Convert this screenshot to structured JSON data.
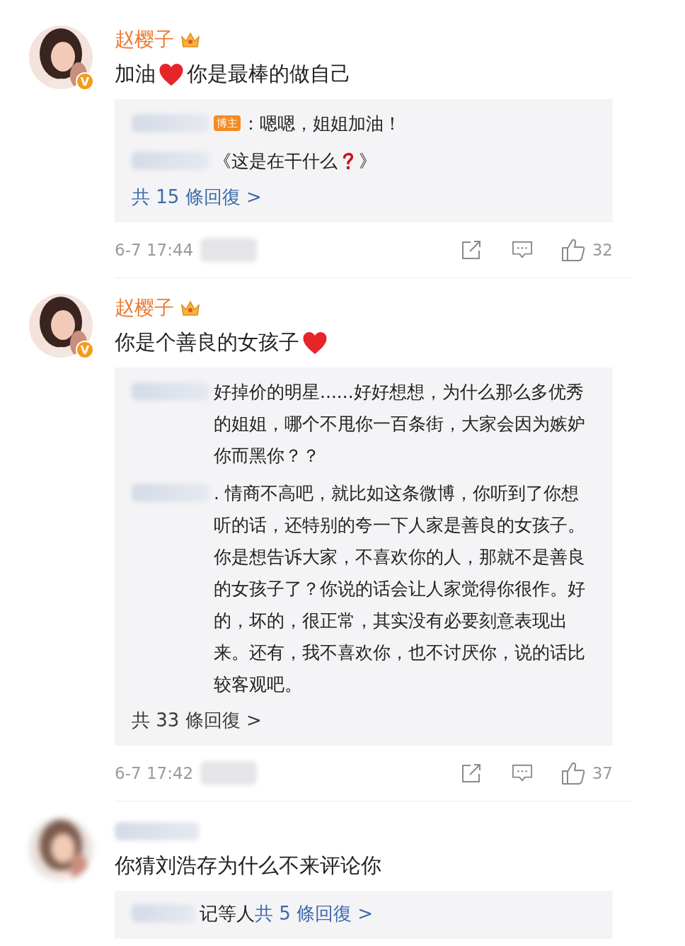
{
  "comments": [
    {
      "avatar": {
        "blurred": false
      },
      "verified": "V",
      "name": {
        "text": "赵樱子",
        "blurred": false
      },
      "crown": true,
      "content": [
        {
          "kind": "text",
          "text": "加油"
        },
        {
          "kind": "heart"
        },
        {
          "kind": "text",
          "text": "你是最棒的做自己"
        }
      ],
      "replies": [
        {
          "badge": "博主",
          "parts": [
            {
              "kind": "text",
              "text": "：嗯嗯，姐姐加油！"
            }
          ]
        },
        {
          "parts": [
            {
              "kind": "text",
              "text": "《这是在干什么"
            },
            {
              "kind": "question"
            },
            {
              "kind": "text",
              "text": "》"
            }
          ]
        }
      ],
      "more": {
        "text": "共 15 條回復 >",
        "color": "#3d6aab"
      },
      "footer": {
        "time": "6-7 17:44",
        "likes": "32"
      }
    },
    {
      "avatar": {
        "blurred": false
      },
      "verified": "V",
      "name": {
        "text": "赵樱子",
        "blurred": false
      },
      "crown": true,
      "content": [
        {
          "kind": "text",
          "text": "你是个善良的女孩子"
        },
        {
          "kind": "heart"
        }
      ],
      "replies": [
        {
          "parts": [
            {
              "kind": "text",
              "text": "好掉价的明星......好好想想，为什么那么多优秀的姐姐，哪个不甩你一百条街，大家会因为嫉妒你而黑你？？"
            }
          ]
        },
        {
          "parts": [
            {
              "kind": "text",
              "text": ". 情商不高吧，就比如这条微博，你听到了你想听的话，还特别的夸一下人家是善良的女孩子。你是想告诉大家，不喜欢你的人，那就不是善良的女孩子了？你说的话会让人家觉得你很作。好的，坏的，很正常，其实没有必要刻意表现出来。还有，我不喜欢你，也不讨厌你，说的话比较客观吧。"
            }
          ]
        }
      ],
      "more": {
        "text": "共 33 條回復 >",
        "color": "#3a3a3a"
      },
      "footer": {
        "time": "6-7 17:42",
        "likes": "37"
      }
    },
    {
      "avatar": {
        "blurred": true
      },
      "name": {
        "blurred": true
      },
      "content": [
        {
          "kind": "text",
          "text": "你猜刘浩存为什么不来评论你"
        }
      ],
      "more": {
        "prefix": "记等人",
        "text": "共 5 條回復 >",
        "color": "#3d6aab"
      }
    }
  ]
}
